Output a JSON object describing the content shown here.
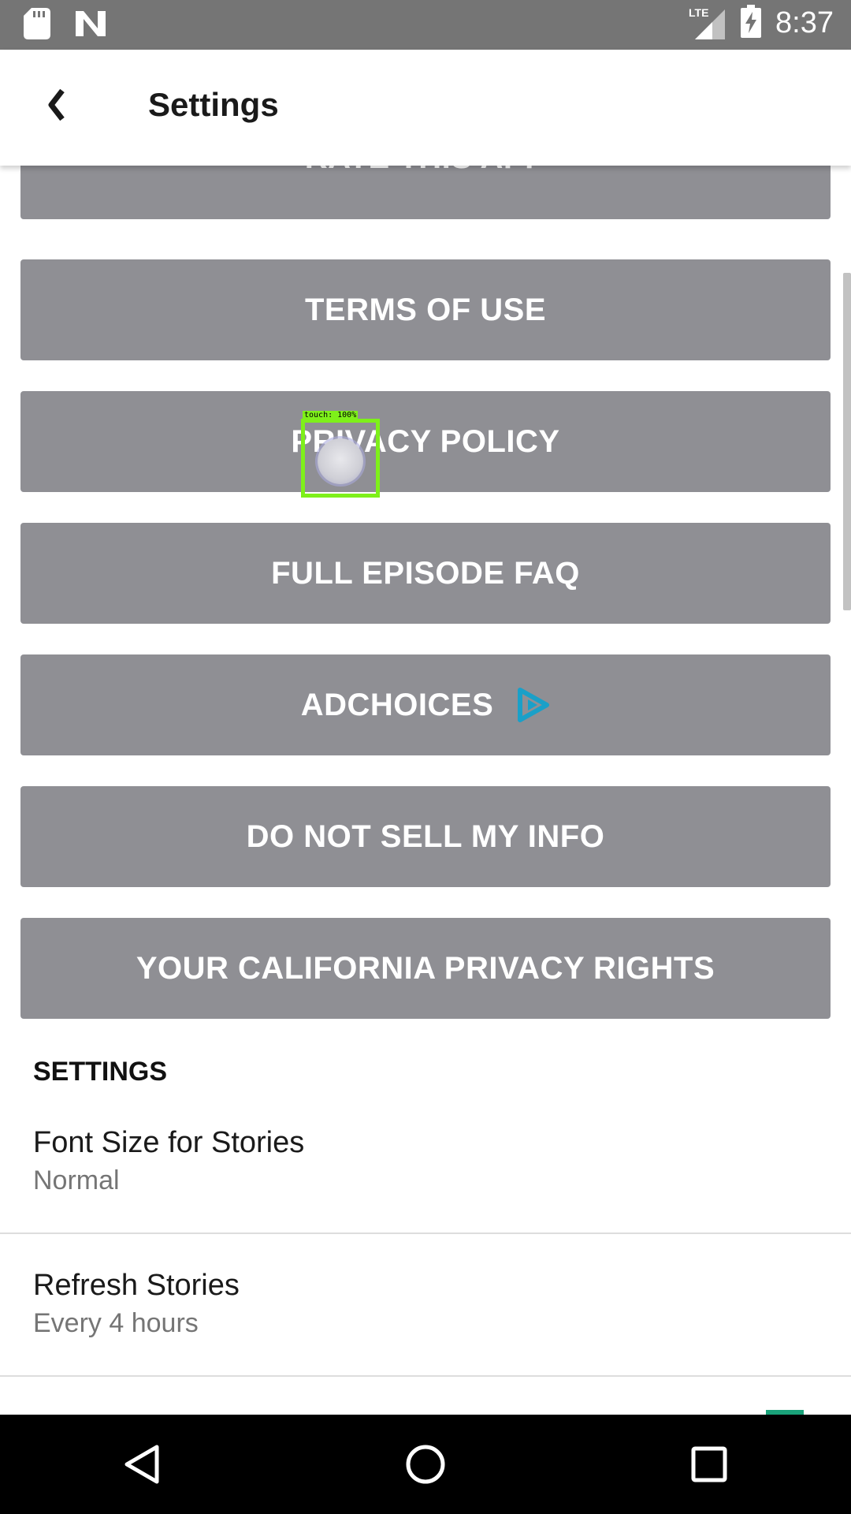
{
  "status_bar": {
    "time": "8:37",
    "network_label": "LTE"
  },
  "header": {
    "title": "Settings",
    "back_icon": "chevron-left-icon"
  },
  "buttons": {
    "rate_app": "RATE THIS APP",
    "terms": "TERMS OF USE",
    "privacy": "PRIVACY POLICY",
    "faq": "FULL EPISODE FAQ",
    "adchoices": "ADCHOICES",
    "do_not_sell": "DO NOT SELL MY INFO",
    "california": "YOUR CALIFORNIA PRIVACY RIGHTS"
  },
  "settings": {
    "section_title": "SETTINGS",
    "items": [
      {
        "title": "Font Size for Stories",
        "value": "Normal"
      },
      {
        "title": "Refresh Stories",
        "value": "Every 4 hours"
      }
    ]
  },
  "touch_indicator": {
    "label": "touch: 100%"
  },
  "colors": {
    "button_bg": "#8f8f94",
    "status_bar": "#757575",
    "adchoices_icon": "#1aa0c8",
    "touch_box": "#7ef01a"
  }
}
